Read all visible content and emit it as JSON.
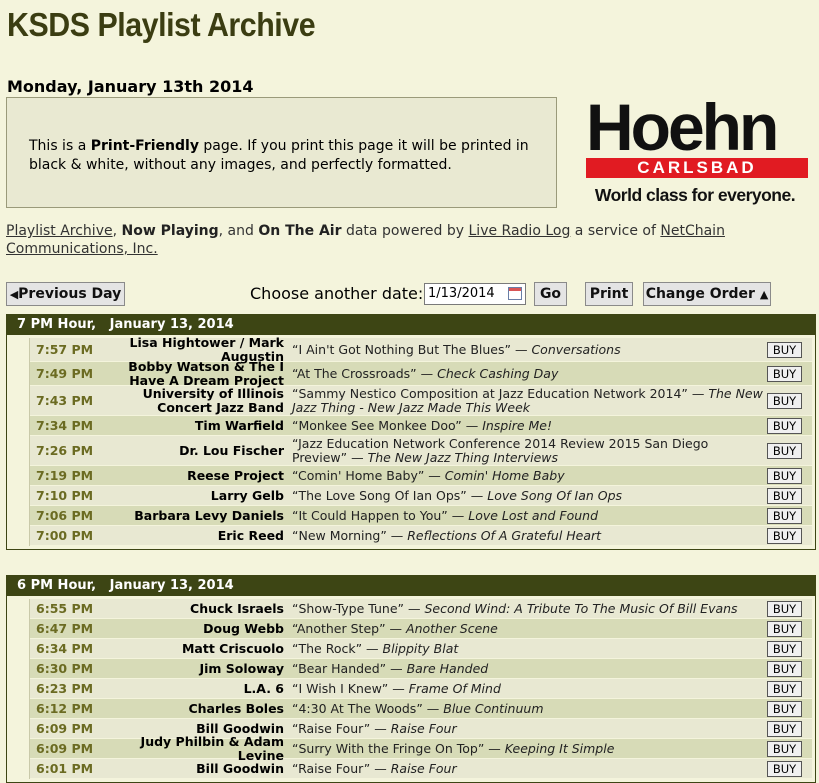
{
  "page": {
    "title": "KSDS Playlist Archive",
    "date_heading": "Monday, January 13th 2014"
  },
  "print_notice": {
    "before": "This is a ",
    "bold": "Print-Friendly",
    "after": " page. If you print this page it will be printed in black & white, without any images, and perfectly formatted."
  },
  "ad": {
    "word": "Hoehn",
    "band": "CARLSBAD",
    "tagline": "World class for everyone."
  },
  "powered": {
    "link1": "Playlist Archive",
    "sep1": ", ",
    "bold1": "Now Playing",
    "sep2": ", and ",
    "bold2": "On The Air",
    "text1": " data powered by ",
    "link2": "Live Radio Log",
    "text2": " a service of ",
    "link3": "NetChain Communications, Inc."
  },
  "controls": {
    "prev_day": "Previous Day",
    "choose_label": "Choose another date:",
    "date_value": "1/13/2014",
    "go": "Go",
    "print": "Print",
    "change_order": "Change Order"
  },
  "buy_label": "BUY",
  "hours": [
    {
      "header": "7 PM Hour,   January 13, 2014",
      "rows": [
        {
          "time": "7:57 PM",
          "artist": "Lisa Hightower / Mark Augustin",
          "song": "“I Ain't Got Nothing But The Blues”",
          "album": "Conversations"
        },
        {
          "time": "7:49 PM",
          "artist": "Bobby Watson & The I Have A Dream Project",
          "song": "“At The Crossroads”",
          "album": "Check Cashing Day"
        },
        {
          "time": "7:43 PM",
          "artist": "University of Illinois Concert Jazz Band",
          "song": "“Sammy Nestico Composition at Jazz Education Network 2014”",
          "album": "The New Jazz Thing - New Jazz Made This Week"
        },
        {
          "time": "7:34 PM",
          "artist": "Tim Warfield",
          "song": "“Monkee See Monkee Doo”",
          "album": "Inspire Me!"
        },
        {
          "time": "7:26 PM",
          "artist": "Dr. Lou Fischer",
          "song": "“Jazz Education Network Conference 2014 Review 2015 San Diego Preview”",
          "album": "The New Jazz Thing Interviews"
        },
        {
          "time": "7:19 PM",
          "artist": "Reese Project",
          "song": "“Comin' Home Baby”",
          "album": "Comin' Home Baby"
        },
        {
          "time": "7:10 PM",
          "artist": "Larry Gelb",
          "song": "“The Love Song Of Ian Ops”",
          "album": "Love Song Of Ian Ops"
        },
        {
          "time": "7:06 PM",
          "artist": "Barbara Levy Daniels",
          "song": "“It Could Happen to You”",
          "album": "Love Lost and Found"
        },
        {
          "time": "7:00 PM",
          "artist": "Eric Reed",
          "song": "“New Morning”",
          "album": "Reflections Of A Grateful Heart"
        }
      ]
    },
    {
      "header": "6 PM Hour,   January 13, 2014",
      "rows": [
        {
          "time": "6:55 PM",
          "artist": "Chuck Israels",
          "song": "“Show-Type Tune”",
          "album": "Second Wind: A Tribute To The Music Of Bill Evans"
        },
        {
          "time": "6:47 PM",
          "artist": "Doug Webb",
          "song": "“Another Step”",
          "album": "Another Scene"
        },
        {
          "time": "6:34 PM",
          "artist": "Matt Criscuolo",
          "song": "“The Rock”",
          "album": "Blippity Blat"
        },
        {
          "time": "6:30 PM",
          "artist": "Jim Soloway",
          "song": "“Bear Handed”",
          "album": "Bare Handed"
        },
        {
          "time": "6:23 PM",
          "artist": "L.A. 6",
          "song": "“I Wish I Knew”",
          "album": "Frame Of Mind"
        },
        {
          "time": "6:12 PM",
          "artist": "Charles Boles",
          "song": "“4:30 At The Woods”",
          "album": "Blue Continuum"
        },
        {
          "time": "6:09 PM",
          "artist": "Bill Goodwin",
          "song": "“Raise Four”",
          "album": "Raise Four"
        },
        {
          "time": "6:09 PM",
          "artist": "Judy Philbin & Adam Levine",
          "song": "“Surry With the Fringe On Top”",
          "album": "Keeping It Simple"
        },
        {
          "time": "6:01 PM",
          "artist": "Bill Goodwin",
          "song": "“Raise Four”",
          "album": "Raise Four"
        }
      ]
    }
  ]
}
